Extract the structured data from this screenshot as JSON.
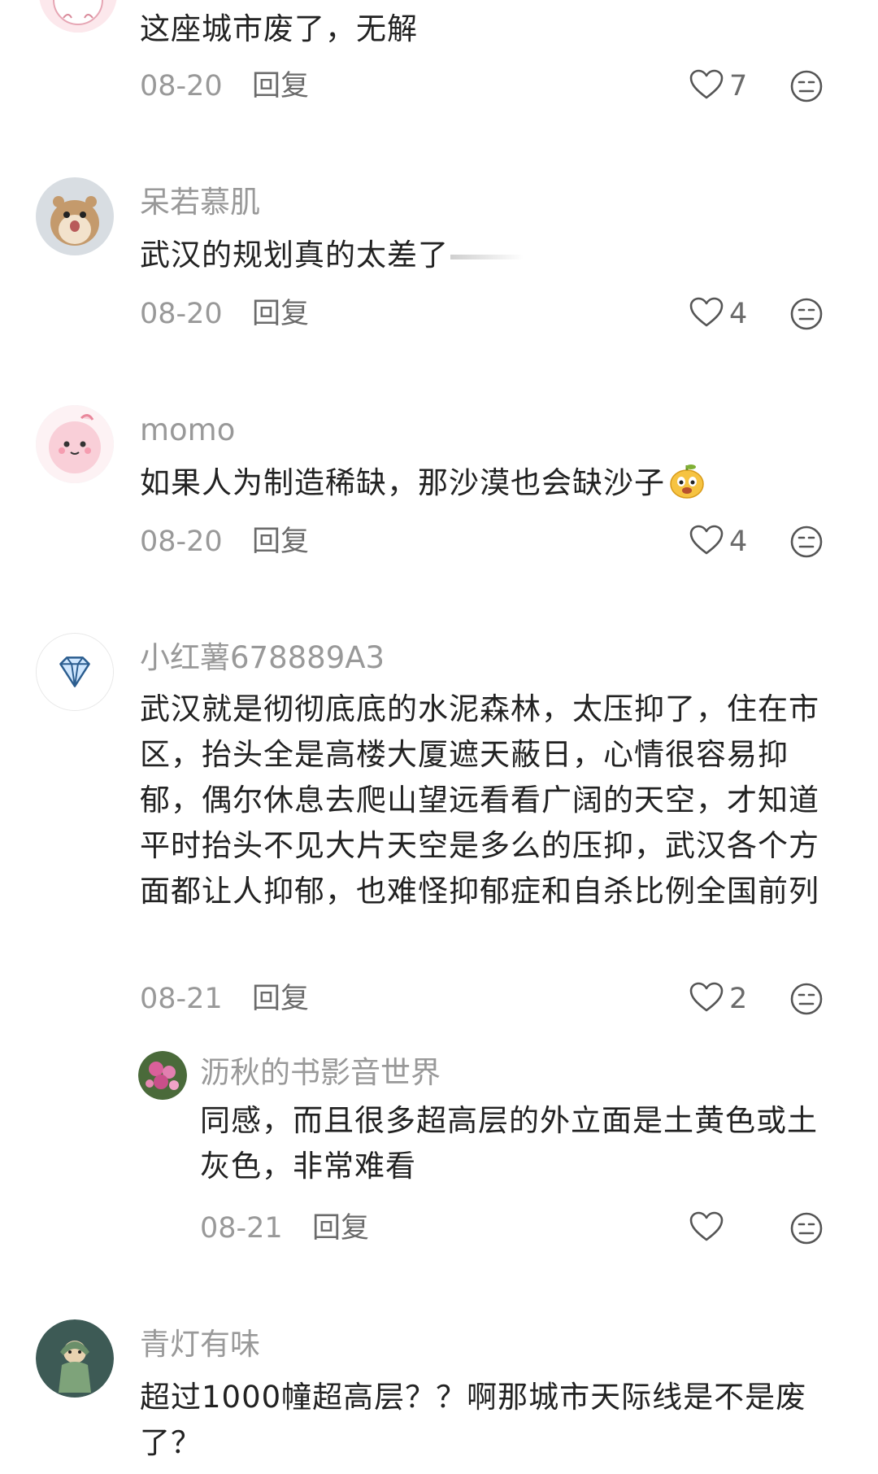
{
  "comments": [
    {
      "user": "",
      "avatar_icon": "pink-character-avatar-icon",
      "text": "这座城市废了，无解",
      "date": "08-20",
      "reply_label": "回复",
      "likes": "7"
    },
    {
      "user": "呆若慕肌",
      "avatar_icon": "hamster-avatar-icon",
      "text": "武汉的规划真的太差了",
      "date": "08-20",
      "reply_label": "回复",
      "likes": "4"
    },
    {
      "user": "momo",
      "avatar_icon": "pink-bunny-avatar-icon",
      "text": "如果人为制造稀缺，那沙漠也会缺沙子",
      "emoji_icon": "pear-face-emoji-icon",
      "date": "08-20",
      "reply_label": "回复",
      "likes": "4"
    },
    {
      "user": "小红薯678889A3",
      "avatar_icon": "diamond-avatar-icon",
      "text": "武汉就是彻彻底底的水泥森林，太压抑了，住在市区，抬头全是高楼大厦遮天蔽日，心情很容易抑郁，偶尔休息去爬山望远看看广阔的天空，才知道平时抬头不见大片天空是多么的压抑，武汉各个方面都让人抑郁，也难怪抑郁症和自杀比例全国前列",
      "date": "08-21",
      "reply_label": "回复",
      "likes": "2",
      "reply": {
        "user": "沥秋的书影音世界",
        "avatar_icon": "flowers-avatar-icon",
        "text": "同感，而且很多超高层的外立面是土黄色或土灰色，非常难看",
        "date": "08-21",
        "reply_label": "回复",
        "likes": ""
      }
    },
    {
      "user": "青灯有味",
      "avatar_icon": "green-figure-avatar-icon",
      "text": "超过1000幢超高层？？啊那城市天际线是不是废了？",
      "date": "",
      "reply_label": "",
      "likes": ""
    }
  ],
  "colors": {
    "text_primary": "#222222",
    "text_secondary": "#999999",
    "action_gray": "#6b6b6b"
  }
}
